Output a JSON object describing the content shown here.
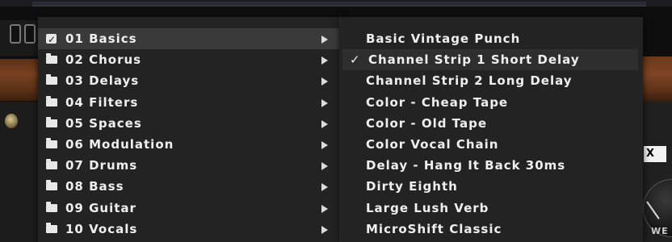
{
  "background": {
    "x_box_label": "X",
    "bottom_right_label": "WE"
  },
  "categories": [
    {
      "label": "01 Basics",
      "icon": "checkbox-icon",
      "state": "selected"
    },
    {
      "label": "02 Chorus",
      "icon": "folder-icon"
    },
    {
      "label": "03 Delays",
      "icon": "folder-icon"
    },
    {
      "label": "04 Filters",
      "icon": "folder-icon"
    },
    {
      "label": "05 Spaces",
      "icon": "folder-icon"
    },
    {
      "label": "06 Modulation",
      "icon": "folder-icon"
    },
    {
      "label": "07 Drums",
      "icon": "folder-icon"
    },
    {
      "label": "08 Bass",
      "icon": "folder-icon"
    },
    {
      "label": "09 Guitar",
      "icon": "folder-icon"
    },
    {
      "label": "10 Vocals",
      "icon": "folder-icon"
    }
  ],
  "presets": [
    {
      "label": "Basic Vintage Punch"
    },
    {
      "label": "Channel Strip 1 Short Delay",
      "checked": true
    },
    {
      "label": "Channel Strip 2 Long Delay"
    },
    {
      "label": "Color - Cheap Tape"
    },
    {
      "label": "Color - Old Tape"
    },
    {
      "label": "Color Vocal Chain"
    },
    {
      "label": "Delay - Hang It Back 30ms"
    },
    {
      "label": "Dirty Eighth"
    },
    {
      "label": "Large Lush Verb"
    },
    {
      "label": "MicroShift Classic"
    }
  ],
  "colors": {
    "menu_bg": "#232323",
    "highlight_left": "#3a3a3a",
    "highlight_right": "#2e2e2e",
    "text": "#efefef",
    "wood": "#7a4120"
  }
}
